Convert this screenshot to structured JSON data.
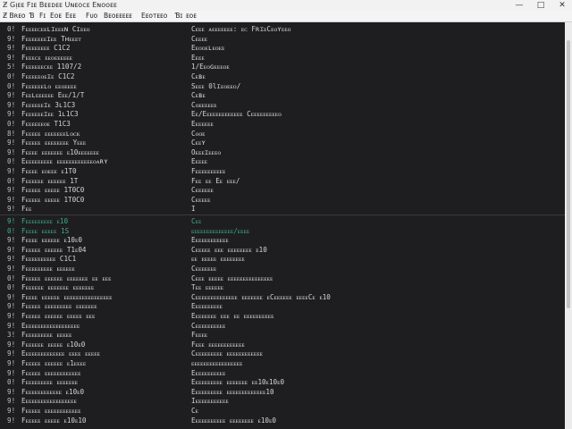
{
  "window": {
    "title": "Ƶ Gᴉᴇᴇ Fɪᴇ Bᴇᴇᴅᴇᴇ Uɴᴇᴏᴄᴇ Eɴᴏᴏᴇᴇ",
    "controls": {
      "minimize": "—",
      "maximize": "□",
      "close": "✕"
    }
  },
  "menubar": {
    "items": [
      "Ƶ Bʀᴇᴏ",
      "Ɓ",
      "Fɪ",
      "Eᴏᴇ",
      "Eᴇᴇ",
      "Fᴜᴏ",
      "Bᴇᴏᴇᴇᴇᴇᴇ",
      "Eᴇᴏᴛᴇᴇᴏ",
      "Ɓɪ",
      "ᴇᴏᴇ"
    ]
  },
  "terminal": {
    "rows_top": [
      {
        "num": "0!",
        "key": "Fᴇᴇᴇᴇᴄᴇᴇʟɪᴇᴇᴇɴ Cɪᴇᴇᴏ",
        "val": "Cᴇᴇᴇ ᴀᴇᴇᴇᴇᴇᴇᴇ: ᴇᴄ FʀɪᴇCᴇᴏʏᴇᴇᴏ"
      },
      {
        "num": "9!",
        "key": "Fᴇᴇᴇᴇᴇᴇᴇɪᴇᴇ Tʜᴇᴇᴇᴛ",
        "val": "Cᴇᴇᴇᴇ"
      },
      {
        "num": "9!",
        "key": "Fᴇᴇᴇᴇᴇᴇᴇᴇ C1C2",
        "val": "Eᴇᴏᴏᴇʟᴇᴏᴇᴇ"
      },
      {
        "num": "9!",
        "key": "Fᴇᴇᴇᴄᴇ ᴇᴇᴏᴇᴇᴇᴇᴇᴇ",
        "val": "Eᴇᴇᴇ"
      },
      {
        "num": "5!",
        "key": "Fᴇᴇᴇᴇᴇᴇᴄᴇᴇ 1107/2",
        "val": "1/Eᴇᴏɢᴇᴇᴇᴏᴇ"
      },
      {
        "num": "0!",
        "key": "Fᴇᴇᴇᴇᴇᴏᴇɪᴇ C1C2",
        "val": "Cᴇʙᴇ"
      },
      {
        "num": "0!",
        "key": "Fᴇᴇᴇᴇᴇᴇʟᴏ ᴇᴇᴏᴇᴇᴇᴇ",
        "val": "Sᴇᴇᴇ 0lɪᴇᴏᴇᴇᴏ/"
      },
      {
        "num": "9!",
        "key": "Fᴇᴇʟᴇᴇᴇᴇᴇᴇ Eᴇᴇ/1/T",
        "val": "Cᴇʙᴇ"
      },
      {
        "num": "9!",
        "key": "Fᴇᴇᴇᴇᴇᴇɪᴇ 3ʟ1C3",
        "val": "Cᴏᴇᴇᴇᴇᴇᴇ"
      },
      {
        "num": "9!",
        "key": "Fᴇᴇᴇᴇᴇᴇɪᴇᴇ 1ʟ1C3",
        "val": "Eᴇ/Eᴇᴇᴇᴇᴇᴇᴇᴇᴇᴇᴇᴇ Cᴇᴇᴇᴇᴇᴇᴇᴇᴇᴏ"
      },
      {
        "num": "0!",
        "key": "Fᴇᴇᴇᴇᴇᴇᴏᴇ T1C3",
        "val": "Eᴇᴇᴇᴇᴇᴇ"
      },
      {
        "num": "8!",
        "key": "Fᴇᴇᴇᴇᴇ ᴇᴇᴇᴇᴇᴇᴇʟᴏᴄᴋ",
        "val": "Cᴏᴏᴇ"
      },
      {
        "num": "9!",
        "key": "Fᴇᴇᴇᴇᴇ ᴇᴇᴇᴇᴇᴇᴇᴇ Yᴇᴇᴇ",
        "val": "Cᴇᴇʏ"
      },
      {
        "num": "9!",
        "key": "Fᴇᴇᴇᴇ ᴇᴇᴇᴇᴇᴇᴇ ᴇ10ᴇᴇᴇᴇᴇᴇᴇ",
        "val": "Oᴇᴇᴇɪᴇᴇᴇᴏ"
      },
      {
        "num": "0!",
        "key": "Eᴇᴇᴇᴇᴇᴇᴇᴇᴇ ᴇᴇᴇᴇᴇᴇᴇᴇᴇᴇᴇᴇᴏᴀʀʏ",
        "val": "Eᴇᴇᴇᴇ"
      },
      {
        "num": "9!",
        "key": "Fᴇᴇᴇᴇ ᴇᴏᴇᴇᴇ ᴇ1T0",
        "val": "Fᴇᴇᴇᴇᴇᴇᴇᴇᴇᴇ"
      },
      {
        "num": "0!",
        "key": "Fᴇᴇᴇᴇᴇᴇ ᴇᴇᴇᴇᴇᴇ 1T",
        "val": "Fᴇᴇ ᴇᴇ Eᴇ ᴇᴇᴇ/"
      },
      {
        "num": "9!",
        "key": "Fᴇᴇᴇᴇᴇ ᴇᴇᴇᴇᴇ 1T0C0",
        "val": "Cᴇᴇᴇᴇᴇᴇ"
      },
      {
        "num": "9!",
        "key": "Fᴇᴇᴇᴇᴇ ᴇᴇᴇᴇᴇ 1T0C0",
        "val": "Cᴇᴇᴇᴇᴇ"
      },
      {
        "num": "9!",
        "key": "Fᴇᴇ",
        "val": "I"
      }
    ],
    "rows_bottom": [
      {
        "num": "9!",
        "key": "Fᴇᴇᴇᴇᴇᴇᴇᴇᴇ ᴇ10",
        "val": "Cᴇᴇ",
        "highlight": true
      },
      {
        "num": "0!",
        "key": "Fᴇᴇᴇᴇ ᴇᴇᴇᴇᴇ 1S",
        "val": "ᴇᴇᴇᴇᴇᴇᴇᴇᴇᴇᴇᴇᴇᴇ/ᴇᴇᴇᴇ",
        "highlight": true
      },
      {
        "num": "9!",
        "key": "Fᴇᴇᴇᴇ ᴇᴇᴇᴇᴇᴇ ᴇ10ᴇ0",
        "val": "Eᴇᴇᴇᴇᴇᴇᴇᴇᴇᴇᴇ"
      },
      {
        "num": "9!",
        "key": "Fᴇᴇᴇᴇᴇ ᴇᴇᴇᴇᴇᴇ T1ᴇ04",
        "val": "Cᴇᴇᴇᴇᴇ ᴇᴇᴇ ᴇᴇᴇᴇᴇᴇᴇᴇ ᴇ10"
      },
      {
        "num": "9!",
        "key": "Fᴇᴇᴇᴇᴇᴇᴇᴇᴇᴇ C1C1",
        "val": "ᴇᴇ ᴇᴇᴇᴇᴇ ᴇᴇᴇᴇᴇᴇᴇᴇ"
      },
      {
        "num": "9!",
        "key": "Fᴇᴇᴇᴇᴇᴇᴇᴇᴇ ᴇᴇᴇᴇᴇᴇ",
        "val": "Cᴇᴇᴇᴇᴇᴇᴇ"
      },
      {
        "num": "0!",
        "key": "Fᴇᴇᴇᴇᴇ ᴇᴇᴇᴇᴇᴇ ᴇᴇᴇᴇᴇᴇᴇ ᴇᴇ ᴇᴇᴇ",
        "val": "Cᴇᴇᴇ ᴇᴇᴇᴇᴇ ᴇᴇᴇᴇᴇᴇᴇᴇᴇᴇᴇᴇᴇᴇᴇ"
      },
      {
        "num": "0!",
        "key": "Fᴇᴇᴇᴇᴇᴇ ᴇᴇᴇᴇᴇᴇᴇ ᴇᴇᴇᴇᴇᴇᴇ",
        "val": "Tᴇᴇ ᴇᴇᴇᴇᴇᴇ"
      },
      {
        "num": "9!",
        "key": "Fᴇᴇᴇᴇ ᴇᴇᴇᴇᴇᴇ ᴇᴇᴇᴇᴇᴇᴇᴇᴇᴇᴇᴇᴇᴇᴇᴇ",
        "val": "Cᴇᴇᴇᴇᴇᴇᴇᴇᴇᴇᴇᴇᴇᴇ ᴇᴇᴇᴇᴇᴇᴇ ᴇCᴇᴇᴇᴇᴇᴇ ᴇᴇᴇᴇCᴇ ᴇ10"
      },
      {
        "num": "9!",
        "key": "Fᴇᴇᴇᴇᴇ ᴇᴇᴇᴇᴇᴇᴇᴇᴇ ᴇᴇᴇᴇᴇᴇᴇ",
        "val": "Eᴇᴇᴇᴇᴇᴇᴇᴇᴇ"
      },
      {
        "num": "9!",
        "key": "Fᴇᴇᴇᴇᴇ ᴇᴇᴇᴇᴇᴇ ᴇᴇᴇᴇᴇ ᴇᴇᴇ",
        "val": "Eᴇᴇᴇᴇᴇᴇᴇ ᴇᴇᴇ ᴇᴇ ᴇᴇᴇᴇᴇᴇᴇᴇᴇᴇ"
      },
      {
        "num": "9!",
        "key": "Eᴇᴇᴇᴇᴇᴇᴇᴇᴇᴇᴇᴇᴇᴇᴇᴇᴇᴇ",
        "val": "Cᴇᴇᴇᴇᴇᴇᴇᴇᴇᴇ"
      },
      {
        "num": "3!",
        "key": "Fᴇᴇᴇᴇᴇᴇᴇᴇᴇ ᴇᴇᴇᴇᴇ",
        "val": "Fᴇᴇᴇᴇ"
      },
      {
        "num": "9!",
        "key": "Fᴇᴇᴇᴇᴇᴇ ᴇᴇᴇᴇᴇ ᴇ10ᴇ0",
        "val": "Fᴇᴇᴇ ᴇᴇᴇᴇᴇᴇᴇᴇᴇᴇᴇᴇ"
      },
      {
        "num": "9!",
        "key": "Eᴇᴇᴇᴇᴇᴇᴇᴇᴇᴇᴇᴇᴇ ᴇᴇᴇᴇ ᴇᴇᴇᴇᴇ",
        "val": "Cᴇᴇᴇᴇᴇᴇᴇᴇᴇ ᴇᴇᴇᴇᴇᴇᴇᴇᴇᴇᴇᴇ"
      },
      {
        "num": "9!",
        "key": "Fᴇᴇᴇᴇᴇ ᴇᴇᴇᴇᴇᴇ ᴇ1ᴇᴇᴇᴇ",
        "val": "ᴇᴇᴇᴇᴇᴇᴇᴇᴇᴇᴇᴇᴇᴇᴇᴇᴇ"
      },
      {
        "num": "9!",
        "key": "Fᴇᴇᴇᴇᴇ ᴇᴇᴇᴇᴇᴇᴇᴇᴇᴇᴇᴇ",
        "val": "Eᴇᴇᴇᴇᴇᴇᴇᴇᴇᴇ"
      },
      {
        "num": "0!",
        "key": "Fᴇᴇᴇᴇᴇᴇᴇᴇᴇ ᴇᴇᴇᴇᴇᴇᴇ",
        "val": "Eᴇᴇᴇᴇᴇᴇᴇᴇᴇ ᴇᴇᴇᴇᴇᴇᴇ ᴇᴇ10ᴇ10ᴇ0"
      },
      {
        "num": "9!",
        "key": "Fᴇᴇᴇᴇᴇᴇᴇᴇᴇᴇᴇᴇ ᴇ10ᴇ0",
        "val": "Eᴇᴇᴇᴇᴇᴇᴇᴇᴇ ᴇᴇᴇᴇᴇᴇᴇᴇᴇᴇᴇᴇᴇ10"
      },
      {
        "num": "9!",
        "key": "Eᴇᴇᴇᴇᴇᴇᴇᴇᴇᴇᴇᴇᴇᴇᴇᴇᴇ",
        "val": "Iᴇᴇᴇᴇᴇᴇᴇᴇᴇᴇᴇ"
      },
      {
        "num": "9!",
        "key": "Fᴇᴇᴇᴇᴇ ᴇᴇᴇᴇᴇᴇᴇᴇᴇᴇᴇᴇ",
        "val": "Cᴇ"
      },
      {
        "num": "9!",
        "key": "Fᴇᴇᴇᴇᴇ ᴇᴇᴇᴇᴇ ᴇ10ᴇ10",
        "val": "Eᴇᴇᴇᴇᴇᴇᴇᴇᴇᴇ ᴇᴇᴇᴇᴇᴇᴇᴇ ᴇ10ᴇ0"
      }
    ]
  },
  "colors": {
    "background": "#1e1e20",
    "text": "#d6d6d6",
    "highlight": "#3fae84",
    "chrome": "#f2f2f2"
  }
}
